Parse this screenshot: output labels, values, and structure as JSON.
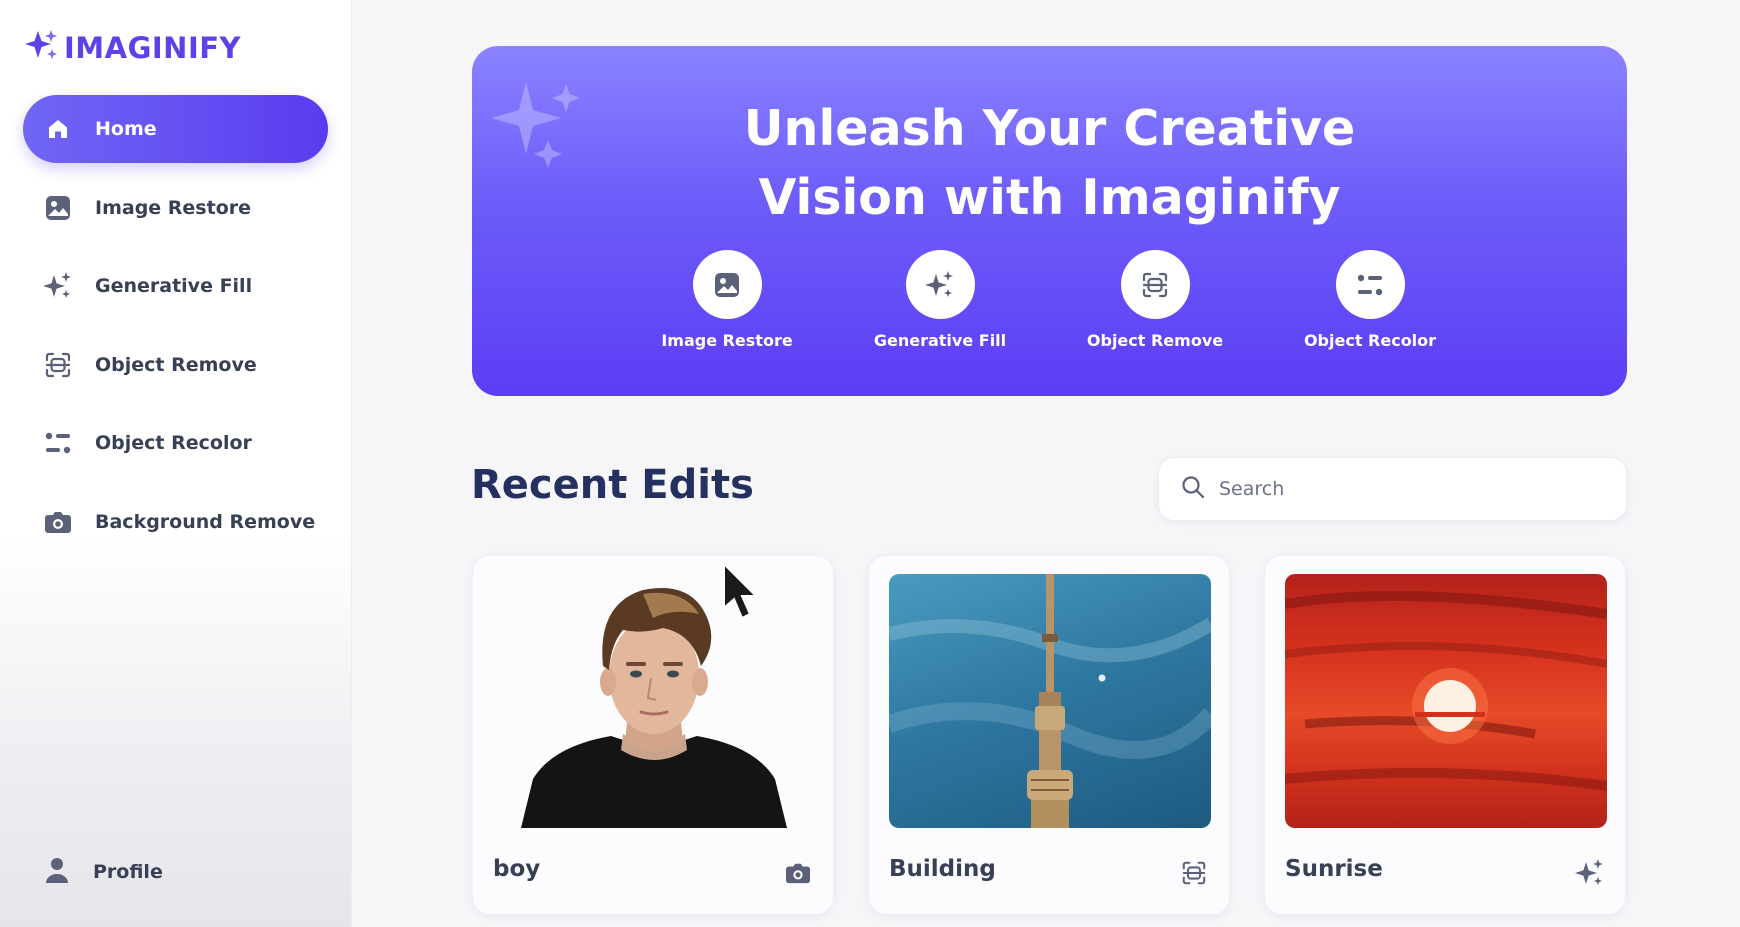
{
  "app": {
    "brand": "IMAGINIFY",
    "accent": "#5b43e8"
  },
  "sidebar": {
    "items": [
      {
        "label": "Home",
        "icon": "home-icon",
        "active": true
      },
      {
        "label": "Image Restore",
        "icon": "image-icon",
        "active": false
      },
      {
        "label": "Generative Fill",
        "icon": "sparkles-icon",
        "active": false
      },
      {
        "label": "Object Remove",
        "icon": "scan-icon",
        "active": false
      },
      {
        "label": "Object Recolor",
        "icon": "filter-icon",
        "active": false
      },
      {
        "label": "Background Remove",
        "icon": "camera-icon",
        "active": false
      }
    ],
    "profile_label": "Profile"
  },
  "hero": {
    "title_line1": "Unleash Your Creative",
    "title_line2": "Vision with Imaginify",
    "actions": [
      {
        "label": "Image Restore",
        "icon": "image-icon"
      },
      {
        "label": "Generative Fill",
        "icon": "sparkles-icon"
      },
      {
        "label": "Object Remove",
        "icon": "scan-icon"
      },
      {
        "label": "Object Recolor",
        "icon": "filter-icon"
      }
    ]
  },
  "recent": {
    "title": "Recent Edits",
    "search_placeholder": "Search",
    "items": [
      {
        "title": "boy",
        "type_icon": "camera-icon"
      },
      {
        "title": "Building",
        "type_icon": "scan-icon"
      },
      {
        "title": "Sunrise",
        "type_icon": "sparkles-icon"
      }
    ]
  }
}
